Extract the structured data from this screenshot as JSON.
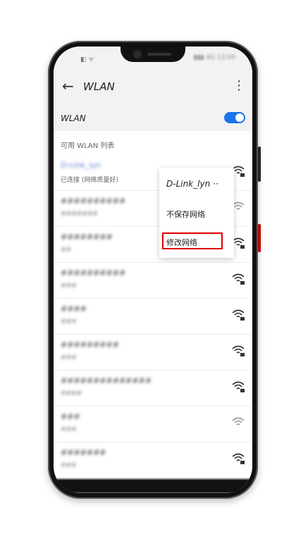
{
  "status_bar": {
    "left_icons": "◧ ᯤ",
    "right_text": "▮▮▮ 4G 12:00"
  },
  "app_bar": {
    "back_icon": "←",
    "title": "WLAN",
    "more_icon": "⋮"
  },
  "wlan_toggle": {
    "label": "WLAN",
    "state": "on",
    "accent": "#1a73e8"
  },
  "section_header": "可用 WLAN 列表",
  "networks": [
    {
      "name": "D-Link_lyn",
      "status": "已连接 (网络质量好)"
    },
    {
      "name": "##########",
      "status": "#######"
    },
    {
      "name": "########",
      "status": "##"
    },
    {
      "name": "##########",
      "status": "###"
    },
    {
      "name": "####",
      "status": "###"
    },
    {
      "name": "#########",
      "status": "###"
    },
    {
      "name": "##############",
      "status": "####"
    },
    {
      "name": "###",
      "status": "###"
    },
    {
      "name": "#######",
      "status": "###"
    }
  ],
  "context_menu": {
    "header": "D-Link_lyn ··",
    "forget": "不保存网络",
    "modify": "修改网络",
    "highlight_color": "#dd0000"
  }
}
